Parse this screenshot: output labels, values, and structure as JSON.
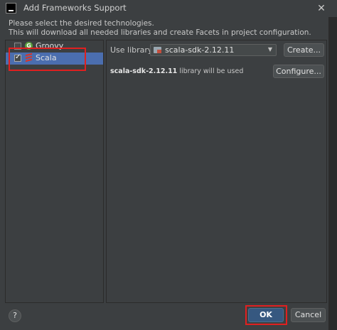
{
  "window": {
    "title": "Add Frameworks Support",
    "close_glyph": "✕"
  },
  "description": {
    "line1": "Please select the desired technologies.",
    "line2": "This will download all needed libraries and create Facets in project configuration."
  },
  "frameworks": [
    {
      "label": "Groovy",
      "checked": false,
      "selected": false,
      "icon": "groovy-icon"
    },
    {
      "label": "Scala",
      "checked": true,
      "selected": true,
      "icon": "scala-icon"
    }
  ],
  "library": {
    "use_label": "Use library:",
    "selected": "scala-sdk-2.12.11",
    "create_label": "Create...",
    "configure_label": "Configure...",
    "note_name": "scala-sdk-2.12.11",
    "note_suffix": " library will be used"
  },
  "footer": {
    "help_label": "?",
    "ok_label": "OK",
    "cancel_label": "Cancel"
  },
  "colors": {
    "background": "#3c3f41",
    "selection": "#4b6eaf",
    "ok_button": "#365880",
    "highlight": "#e02020"
  }
}
